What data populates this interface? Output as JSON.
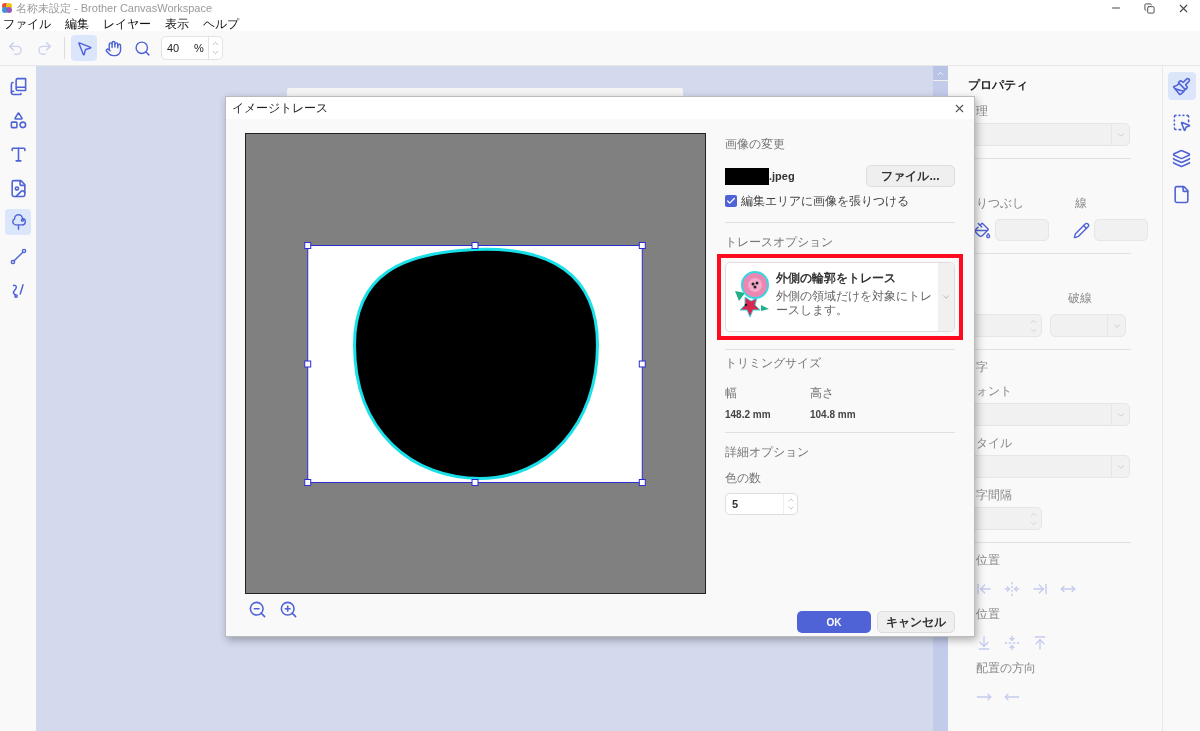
{
  "window": {
    "title": "名称未設定 - Brother CanvasWorkspace"
  },
  "menu": [
    "ファイル",
    "編集",
    "レイヤー",
    "表示",
    "ヘルプ"
  ],
  "toolbar": {
    "tools": [
      {
        "kind": "select",
        "selected": true
      },
      {
        "kind": "hand",
        "selected": false
      },
      {
        "kind": "zoom",
        "selected": false
      }
    ],
    "zoom_value": "40",
    "zoom_unit": "%"
  },
  "left_tools": [
    {
      "kind": "pages",
      "selected": false
    },
    {
      "kind": "shapes",
      "selected": false
    },
    {
      "kind": "text",
      "selected": false
    },
    {
      "kind": "svg",
      "selected": false
    },
    {
      "kind": "trace",
      "selected": true
    },
    {
      "kind": "line",
      "selected": false
    },
    {
      "kind": "freehand",
      "selected": false
    }
  ],
  "right_tabs": [
    {
      "kind": "brush",
      "selected": true
    },
    {
      "kind": "transform",
      "selected": false
    },
    {
      "kind": "layers",
      "selected": false
    },
    {
      "kind": "page",
      "selected": false
    }
  ],
  "properties": {
    "title": "プロパティ",
    "sections": [
      {
        "heading": "理",
        "items": [
          {
            "kind": "select"
          }
        ]
      },
      {
        "items": [
          {
            "kind": "pair",
            "fields": [
              {
                "label": "りつぶし",
                "kind": "fill-color"
              },
              {
                "label": "線",
                "kind": "stroke-color"
              }
            ]
          }
        ]
      },
      {
        "items": [
          {
            "kind": "pair",
            "fields": [
              {
                "kind": "spinner"
              },
              {
                "label": "破線",
                "kind": "select"
              }
            ]
          }
        ]
      },
      {
        "heading": "字",
        "items": [
          {
            "kind": "label",
            "text": "ォント"
          },
          {
            "kind": "select"
          },
          {
            "kind": "label",
            "text": "タイル"
          },
          {
            "kind": "select"
          },
          {
            "kind": "label",
            "text": "字間隔"
          },
          {
            "kind": "spinner"
          }
        ]
      },
      {
        "heading": "位置",
        "items": [
          {
            "kind": "align-h"
          },
          {
            "kind": "label",
            "text": "位置"
          },
          {
            "kind": "align-v"
          },
          {
            "kind": "label",
            "text": "配置の方向"
          },
          {
            "kind": "direction"
          }
        ]
      }
    ]
  },
  "dialog": {
    "title": "イメージトレース",
    "image_change": {
      "heading": "画像の変更",
      "filename": ".jpeg",
      "file_button": "ファイル...",
      "paste_checkbox": {
        "label": "編集エリアに画像を張りつける",
        "checked": true
      }
    },
    "trace_options": {
      "heading": "トレースオプション",
      "option": {
        "title": "外側の輪郭をトレース",
        "description": "外側の領域だけを対象にトレースします。",
        "highlighted": true
      }
    },
    "trimming": {
      "heading": "トリミングサイズ",
      "width_label": "幅",
      "width": "148.2 mm",
      "height_label": "高さ",
      "height": "104.8 mm"
    },
    "advanced": {
      "heading": "詳細オプション",
      "colors_label": "色の数",
      "colors_value": "5"
    },
    "buttons": {
      "ok": "OK",
      "cancel": "キャンセル"
    }
  }
}
